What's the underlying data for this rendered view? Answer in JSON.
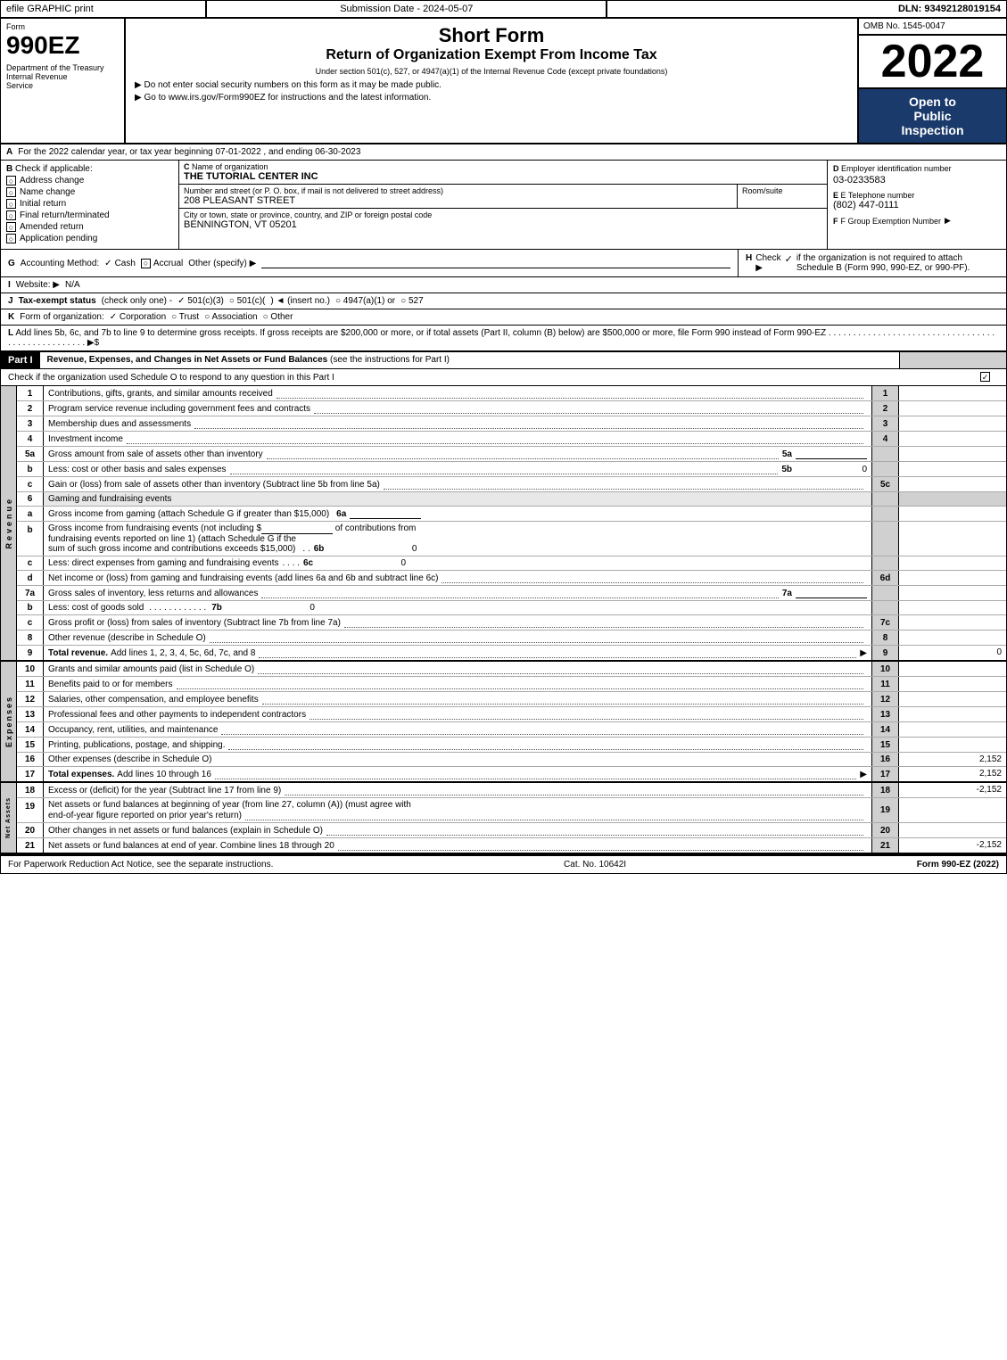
{
  "topBar": {
    "efile": "efile GRAPHIC print",
    "submission": "Submission Date - 2024-05-07",
    "dln": "DLN: 93492128019154"
  },
  "header": {
    "formNumber": "990EZ",
    "shortFormTitle": "Short Form",
    "returnTitle": "Return of Organization Exempt From Income Tax",
    "subtitle1": "Under section 501(c), 527, or 4947(a)(1) of the Internal Revenue Code (except private foundations)",
    "bullet1": "▶ Do not enter social security numbers on this form as it may be made public.",
    "bullet2": "▶ Go to www.irs.gov/Form990EZ for instructions and the latest information.",
    "department": "Department of the Treasury",
    "treasury": "Internal Revenue",
    "service": "Service",
    "ombNo": "OMB No. 1545-0047",
    "year": "2022",
    "openToPublic": "Open to",
    "publicLabel": "Public",
    "inspectionLabel": "Inspection"
  },
  "sectionA": {
    "label": "A",
    "text": "For the 2022 calendar year, or tax year beginning 07-01-2022 , and ending 06-30-2023"
  },
  "sectionB": {
    "label": "B",
    "checkLabel": "Check if applicable:",
    "checks": [
      {
        "id": "address-change",
        "label": "Address change",
        "checked": false
      },
      {
        "id": "name-change",
        "label": "Name change",
        "checked": false
      },
      {
        "id": "initial-return",
        "label": "Initial return",
        "checked": false
      },
      {
        "id": "final-return",
        "label": "Final return/terminated",
        "checked": false
      },
      {
        "id": "amended-return",
        "label": "Amended return",
        "checked": false
      },
      {
        "id": "application-pending",
        "label": "Application pending",
        "checked": false
      }
    ]
  },
  "sectionC": {
    "label": "C",
    "nameLabel": "Name of organization",
    "orgName": "THE TUTORIAL CENTER INC",
    "streetLabel": "Number and street (or P. O. box, if mail is not delivered to street address)",
    "street": "208 PLEASANT STREET",
    "roomSuiteLabel": "Room/suite",
    "roomSuite": "",
    "cityLabel": "City or town, state or province, country, and ZIP or foreign postal code",
    "city": "BENNINGTON, VT  05201"
  },
  "sectionD": {
    "label": "D",
    "einLabel": "Employer identification number",
    "ein": "03-0233583",
    "phoneLabel": "E Telephone number",
    "phone": "(802) 447-0111",
    "groupExemptLabel": "F Group Exemption Number",
    "groupExempt": ""
  },
  "sectionG": {
    "label": "G",
    "accountingLabel": "Accounting Method:",
    "cashChecked": true,
    "accrualChecked": false,
    "cashLabel": "Cash",
    "accrualLabel": "Accrual",
    "otherLabel": "Other (specify) ▶"
  },
  "sectionH": {
    "label": "H",
    "text": "Check ▶",
    "checkText": "✓",
    "description": "if the organization is not required to attach Schedule B (Form 990, 990-EZ, or 990-PF)."
  },
  "sectionI": {
    "label": "I",
    "websiteLabel": "Website: ▶",
    "website": "N/A"
  },
  "sectionJ": {
    "label": "J",
    "taxStatusLabel": "Tax-exempt status",
    "checkOnly": "(check only one) -",
    "options": [
      "✓ 501(c)(3)",
      "○ 501(c)(",
      ") ◄ (insert no.)",
      "○ 4947(a)(1) or",
      "○ 527"
    ]
  },
  "sectionK": {
    "label": "K",
    "formOrgLabel": "Form of organization:",
    "options": [
      "✓ Corporation",
      "○ Trust",
      "○ Association",
      "○ Other"
    ]
  },
  "sectionL": {
    "label": "L",
    "text": "Add lines 5b, 6c, and 7b to line 9 to determine gross receipts. If gross receipts are $200,000 or more, or if total assets (Part II, column (B) below) are $500,000 or more, file Form 990 instead of Form 990-EZ",
    "dots": ". . . . . . . . . . . . . . . . . . . . . . . . . . . . . . . . . . . . . . . . . . . . . . . . . . ▶$"
  },
  "partI": {
    "label": "Part I",
    "title": "Revenue, Expenses, and Changes in Net Assets or Fund Balances",
    "titleNote": "(see the instructions for Part I)",
    "checkText": "Check if the organization used Schedule O to respond to any question in this Part I",
    "rows": [
      {
        "num": "1",
        "desc": "Contributions, gifts, grants, and similar amounts received",
        "dots": true,
        "lineNum": "1",
        "value": ""
      },
      {
        "num": "2",
        "desc": "Program service revenue including government fees and contracts",
        "dots": true,
        "lineNum": "2",
        "value": ""
      },
      {
        "num": "3",
        "desc": "Membership dues and assessments",
        "dots": true,
        "lineNum": "3",
        "value": ""
      },
      {
        "num": "4",
        "desc": "Investment income",
        "dots": true,
        "lineNum": "4",
        "value": ""
      }
    ],
    "row5a": {
      "num": "5a",
      "desc": "Gross amount from sale of assets other than inventory",
      "dots": true,
      "inlineNum": "5a",
      "value": ""
    },
    "row5b": {
      "num": "b",
      "desc": "Less: cost or other basis and sales expenses",
      "dots": true,
      "inlineNum": "5b",
      "value": "0"
    },
    "row5c": {
      "num": "c",
      "desc": "Gain or (loss) from sale of assets other than inventory (Subtract line 5b from line 5a)",
      "dots": true,
      "lineNum": "5c",
      "value": ""
    },
    "row6": {
      "num": "6",
      "desc": "Gaming and fundraising events",
      "shaded": true
    },
    "row6a": {
      "num": "a",
      "desc": "Gross income from gaming (attach Schedule G if greater than $15,000)",
      "inlineNum": "6a",
      "value": ""
    },
    "row6b": {
      "num": "b",
      "desc": "Gross income from fundraising events (not including $______ of contributions from fundraising events reported on line 1) (attach Schedule G if the sum of such gross income and contributions exceeds $15,000)",
      "inlineNum": "6b",
      "value": "0"
    },
    "row6c": {
      "num": "c",
      "desc": "Less: direct expenses from gaming and fundraising events",
      "inlineNum": "6c",
      "value": "0"
    },
    "row6d": {
      "num": "d",
      "desc": "Net income or (loss) from gaming and fundraising events (add lines 6a and 6b and subtract line 6c)",
      "lineNum": "6d",
      "value": ""
    },
    "row7a": {
      "num": "7a",
      "desc": "Gross sales of inventory, less returns and allowances",
      "inlineNum": "7a",
      "value": ""
    },
    "row7b": {
      "num": "b",
      "desc": "Less: cost of goods sold",
      "inlineNum": "7b",
      "value": "0"
    },
    "row7c": {
      "num": "c",
      "desc": "Gross profit or (loss) from sales of inventory (Subtract line 7b from line 7a)",
      "dots": true,
      "lineNum": "7c",
      "value": ""
    },
    "row8": {
      "num": "8",
      "desc": "Other revenue (describe in Schedule O)",
      "dots": true,
      "lineNum": "8",
      "value": ""
    },
    "row9": {
      "num": "9",
      "desc": "Total revenue. Add lines 1, 2, 3, 4, 5c, 6d, 7c, and 8",
      "dots": true,
      "lineNum": "9",
      "value": "0",
      "bold": true
    }
  },
  "partIExpenses": {
    "rows": [
      {
        "num": "10",
        "desc": "Grants and similar amounts paid (list in Schedule O)",
        "dots": true,
        "lineNum": "10",
        "value": ""
      },
      {
        "num": "11",
        "desc": "Benefits paid to or for members",
        "dots": true,
        "lineNum": "11",
        "value": ""
      },
      {
        "num": "12",
        "desc": "Salaries, other compensation, and employee benefits",
        "dots": true,
        "lineNum": "12",
        "value": ""
      },
      {
        "num": "13",
        "desc": "Professional fees and other payments to independent contractors",
        "dots": true,
        "lineNum": "13",
        "value": ""
      },
      {
        "num": "14",
        "desc": "Occupancy, rent, utilities, and maintenance",
        "dots": true,
        "lineNum": "14",
        "value": ""
      },
      {
        "num": "15",
        "desc": "Printing, publications, postage, and shipping.",
        "dots": true,
        "lineNum": "15",
        "value": ""
      },
      {
        "num": "16",
        "desc": "Other expenses (describe in Schedule O)",
        "lineNum": "16",
        "value": "2,152"
      },
      {
        "num": "17",
        "desc": "Total expenses. Add lines 10 through 16",
        "dots": true,
        "lineNum": "17",
        "value": "2,152",
        "bold": true
      }
    ]
  },
  "partINetAssets": {
    "rows": [
      {
        "num": "18",
        "desc": "Excess or (deficit) for the year (Subtract line 17 from line 9)",
        "dots": true,
        "lineNum": "18",
        "value": "-2,152"
      },
      {
        "num": "19",
        "desc": "Net assets or fund balances at beginning of year (from line 27, column (A)) (must agree with end-of-year figure reported on prior year's return)",
        "dots": true,
        "lineNum": "19",
        "value": ""
      },
      {
        "num": "20",
        "desc": "Other changes in net assets or fund balances (explain in Schedule O)",
        "dots": true,
        "lineNum": "20",
        "value": ""
      },
      {
        "num": "21",
        "desc": "Net assets or fund balances at end of year. Combine lines 18 through 20",
        "dots": true,
        "lineNum": "21",
        "value": "-2,152"
      }
    ]
  },
  "footer": {
    "paperworkText": "For Paperwork Reduction Act Notice, see the separate instructions.",
    "catNo": "Cat. No. 10642I",
    "formRef": "Form 990-EZ (2022)"
  }
}
